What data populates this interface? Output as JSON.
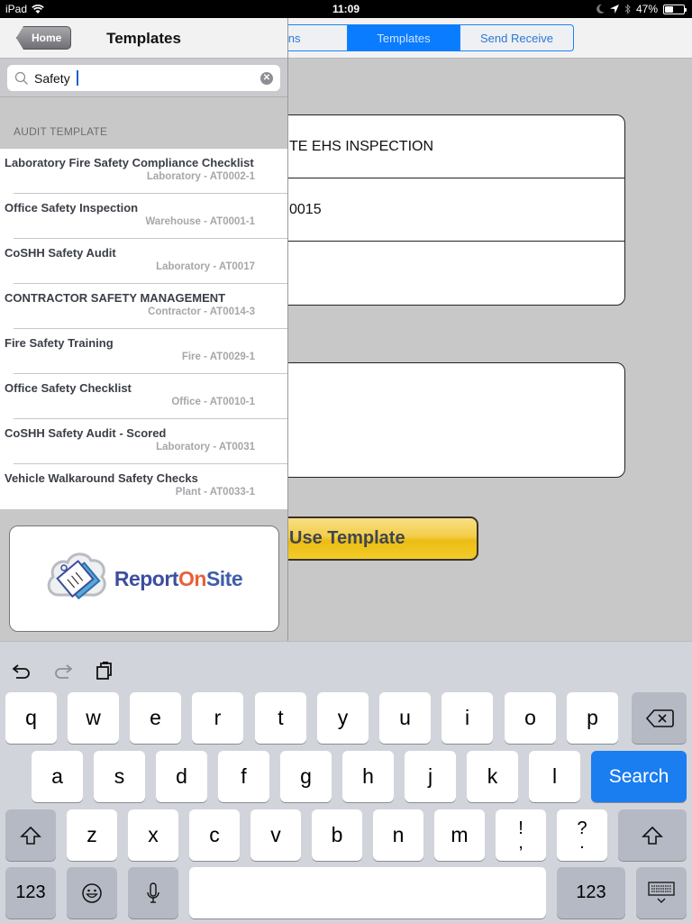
{
  "status_bar": {
    "device": "iPad",
    "time": "11:09",
    "battery_percent": "47%",
    "battery_level": 0.47
  },
  "segmented_control": {
    "segments": [
      {
        "label": "ons",
        "active": false
      },
      {
        "label": "Templates",
        "active": true
      },
      {
        "label": "Send Receive",
        "active": false
      }
    ]
  },
  "form": {
    "rows": [
      {
        "value": "TE EHS INSPECTION"
      },
      {
        "value": "0015"
      },
      {
        "value": ""
      }
    ],
    "notes_value": "",
    "use_template_label": "Use Template"
  },
  "sidebar": {
    "back_label": "Home",
    "title": "Templates",
    "search": {
      "value": "Safety",
      "placeholder": "Search"
    },
    "section_header": "AUDIT TEMPLATE",
    "items": [
      {
        "title": "Laboratory Fire Safety Compliance Checklist",
        "subtitle": "Laboratory - AT0002-1"
      },
      {
        "title": "Office Safety Inspection",
        "subtitle": "Warehouse - AT0001-1"
      },
      {
        "title": "CoSHH Safety Audit",
        "subtitle": "Laboratory - AT0017"
      },
      {
        "title": "CONTRACTOR SAFETY MANAGEMENT",
        "subtitle": "Contractor - AT0014-3"
      },
      {
        "title": "Fire Safety Training",
        "subtitle": "Fire - AT0029-1"
      },
      {
        "title": "Office Safety Checklist",
        "subtitle": "Office - AT0010-1"
      },
      {
        "title": "CoSHH Safety Audit - Scored",
        "subtitle": "Laboratory - AT0031"
      },
      {
        "title": "Vehicle Walkaround Safety Checks",
        "subtitle": "Plant - AT0033-1"
      }
    ],
    "logo": {
      "part1": "Report",
      "part2": "On",
      "part3": "Site"
    }
  },
  "keyboard": {
    "row1": [
      "q",
      "w",
      "e",
      "r",
      "t",
      "y",
      "u",
      "i",
      "o",
      "p"
    ],
    "row2": [
      "a",
      "s",
      "d",
      "f",
      "g",
      "h",
      "j",
      "k",
      "l"
    ],
    "row3": [
      "z",
      "x",
      "c",
      "v",
      "b",
      "n",
      "m"
    ],
    "punct1": {
      "top": "!",
      "bottom": ","
    },
    "punct2": {
      "top": "?",
      "bottom": "."
    },
    "search_label": "Search",
    "numbers_label": "123"
  }
}
